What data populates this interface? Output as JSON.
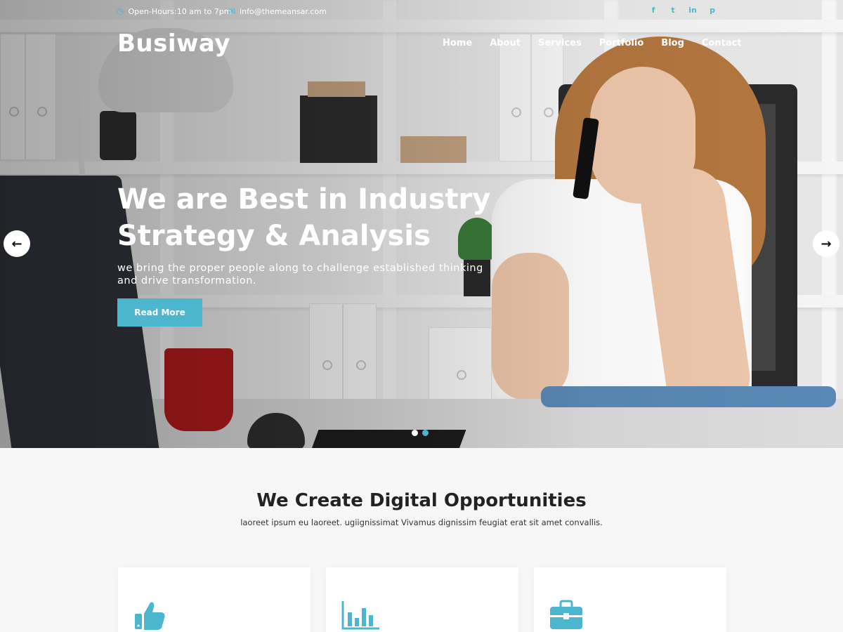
{
  "topbar": {
    "hours": "Open-Hours:10 am to 7pm",
    "email": "info@themeansar.com",
    "social": [
      "f",
      "t",
      "in",
      "p"
    ]
  },
  "header": {
    "logo": "Busiway",
    "nav": [
      "Home",
      "About",
      "Services",
      "Portfolio",
      "Blog",
      "Contact"
    ]
  },
  "hero": {
    "title_line1": "We are Best in Industry",
    "title_line2": "Strategy & Analysis",
    "subtitle_line1": "we bring the proper people along to challenge established thinking",
    "subtitle_line2": "and drive transformation.",
    "button": "Read More",
    "arrow_left": "←",
    "arrow_right": "→",
    "slides": 2,
    "active_slide": 1
  },
  "section": {
    "title": "We Create Digital Opportunities",
    "subtitle": "laoreet ipsum eu laoreet. ugiignissimat Vivamus dignissim feugiat erat sit amet convallis."
  },
  "cards": [
    {
      "icon": "thumbs-up-icon"
    },
    {
      "icon": "bar-chart-icon"
    },
    {
      "icon": "briefcase-icon"
    }
  ],
  "colors": {
    "accent": "#4db6cf",
    "heading": "#222222",
    "background": "#f7f7f7"
  }
}
